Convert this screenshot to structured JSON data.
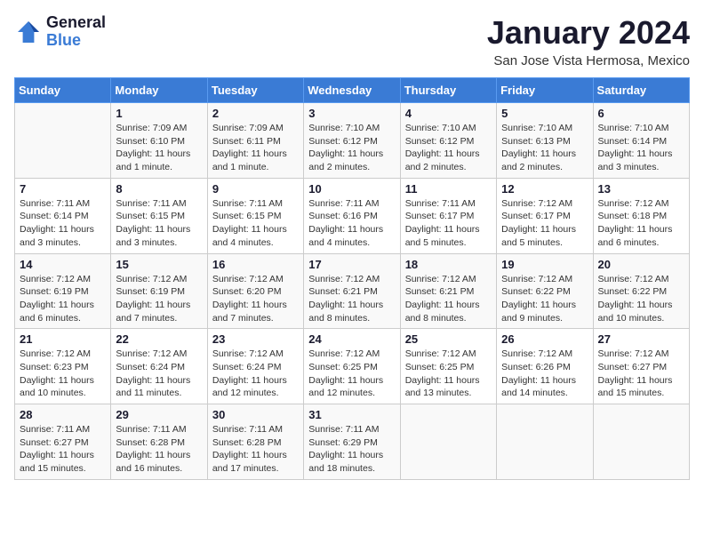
{
  "header": {
    "logo_line1": "General",
    "logo_line2": "Blue",
    "title": "January 2024",
    "subtitle": "San Jose Vista Hermosa, Mexico"
  },
  "days_of_week": [
    "Sunday",
    "Monday",
    "Tuesday",
    "Wednesday",
    "Thursday",
    "Friday",
    "Saturday"
  ],
  "weeks": [
    [
      {
        "day": "",
        "info": ""
      },
      {
        "day": "1",
        "info": "Sunrise: 7:09 AM\nSunset: 6:10 PM\nDaylight: 11 hours and 1 minute."
      },
      {
        "day": "2",
        "info": "Sunrise: 7:09 AM\nSunset: 6:11 PM\nDaylight: 11 hours and 1 minute."
      },
      {
        "day": "3",
        "info": "Sunrise: 7:10 AM\nSunset: 6:12 PM\nDaylight: 11 hours and 2 minutes."
      },
      {
        "day": "4",
        "info": "Sunrise: 7:10 AM\nSunset: 6:12 PM\nDaylight: 11 hours and 2 minutes."
      },
      {
        "day": "5",
        "info": "Sunrise: 7:10 AM\nSunset: 6:13 PM\nDaylight: 11 hours and 2 minutes."
      },
      {
        "day": "6",
        "info": "Sunrise: 7:10 AM\nSunset: 6:14 PM\nDaylight: 11 hours and 3 minutes."
      }
    ],
    [
      {
        "day": "7",
        "info": "Sunrise: 7:11 AM\nSunset: 6:14 PM\nDaylight: 11 hours and 3 minutes."
      },
      {
        "day": "8",
        "info": "Sunrise: 7:11 AM\nSunset: 6:15 PM\nDaylight: 11 hours and 3 minutes."
      },
      {
        "day": "9",
        "info": "Sunrise: 7:11 AM\nSunset: 6:15 PM\nDaylight: 11 hours and 4 minutes."
      },
      {
        "day": "10",
        "info": "Sunrise: 7:11 AM\nSunset: 6:16 PM\nDaylight: 11 hours and 4 minutes."
      },
      {
        "day": "11",
        "info": "Sunrise: 7:11 AM\nSunset: 6:17 PM\nDaylight: 11 hours and 5 minutes."
      },
      {
        "day": "12",
        "info": "Sunrise: 7:12 AM\nSunset: 6:17 PM\nDaylight: 11 hours and 5 minutes."
      },
      {
        "day": "13",
        "info": "Sunrise: 7:12 AM\nSunset: 6:18 PM\nDaylight: 11 hours and 6 minutes."
      }
    ],
    [
      {
        "day": "14",
        "info": "Sunrise: 7:12 AM\nSunset: 6:19 PM\nDaylight: 11 hours and 6 minutes."
      },
      {
        "day": "15",
        "info": "Sunrise: 7:12 AM\nSunset: 6:19 PM\nDaylight: 11 hours and 7 minutes."
      },
      {
        "day": "16",
        "info": "Sunrise: 7:12 AM\nSunset: 6:20 PM\nDaylight: 11 hours and 7 minutes."
      },
      {
        "day": "17",
        "info": "Sunrise: 7:12 AM\nSunset: 6:21 PM\nDaylight: 11 hours and 8 minutes."
      },
      {
        "day": "18",
        "info": "Sunrise: 7:12 AM\nSunset: 6:21 PM\nDaylight: 11 hours and 8 minutes."
      },
      {
        "day": "19",
        "info": "Sunrise: 7:12 AM\nSunset: 6:22 PM\nDaylight: 11 hours and 9 minutes."
      },
      {
        "day": "20",
        "info": "Sunrise: 7:12 AM\nSunset: 6:22 PM\nDaylight: 11 hours and 10 minutes."
      }
    ],
    [
      {
        "day": "21",
        "info": "Sunrise: 7:12 AM\nSunset: 6:23 PM\nDaylight: 11 hours and 10 minutes."
      },
      {
        "day": "22",
        "info": "Sunrise: 7:12 AM\nSunset: 6:24 PM\nDaylight: 11 hours and 11 minutes."
      },
      {
        "day": "23",
        "info": "Sunrise: 7:12 AM\nSunset: 6:24 PM\nDaylight: 11 hours and 12 minutes."
      },
      {
        "day": "24",
        "info": "Sunrise: 7:12 AM\nSunset: 6:25 PM\nDaylight: 11 hours and 12 minutes."
      },
      {
        "day": "25",
        "info": "Sunrise: 7:12 AM\nSunset: 6:25 PM\nDaylight: 11 hours and 13 minutes."
      },
      {
        "day": "26",
        "info": "Sunrise: 7:12 AM\nSunset: 6:26 PM\nDaylight: 11 hours and 14 minutes."
      },
      {
        "day": "27",
        "info": "Sunrise: 7:12 AM\nSunset: 6:27 PM\nDaylight: 11 hours and 15 minutes."
      }
    ],
    [
      {
        "day": "28",
        "info": "Sunrise: 7:11 AM\nSunset: 6:27 PM\nDaylight: 11 hours and 15 minutes."
      },
      {
        "day": "29",
        "info": "Sunrise: 7:11 AM\nSunset: 6:28 PM\nDaylight: 11 hours and 16 minutes."
      },
      {
        "day": "30",
        "info": "Sunrise: 7:11 AM\nSunset: 6:28 PM\nDaylight: 11 hours and 17 minutes."
      },
      {
        "day": "31",
        "info": "Sunrise: 7:11 AM\nSunset: 6:29 PM\nDaylight: 11 hours and 18 minutes."
      },
      {
        "day": "",
        "info": ""
      },
      {
        "day": "",
        "info": ""
      },
      {
        "day": "",
        "info": ""
      }
    ]
  ]
}
